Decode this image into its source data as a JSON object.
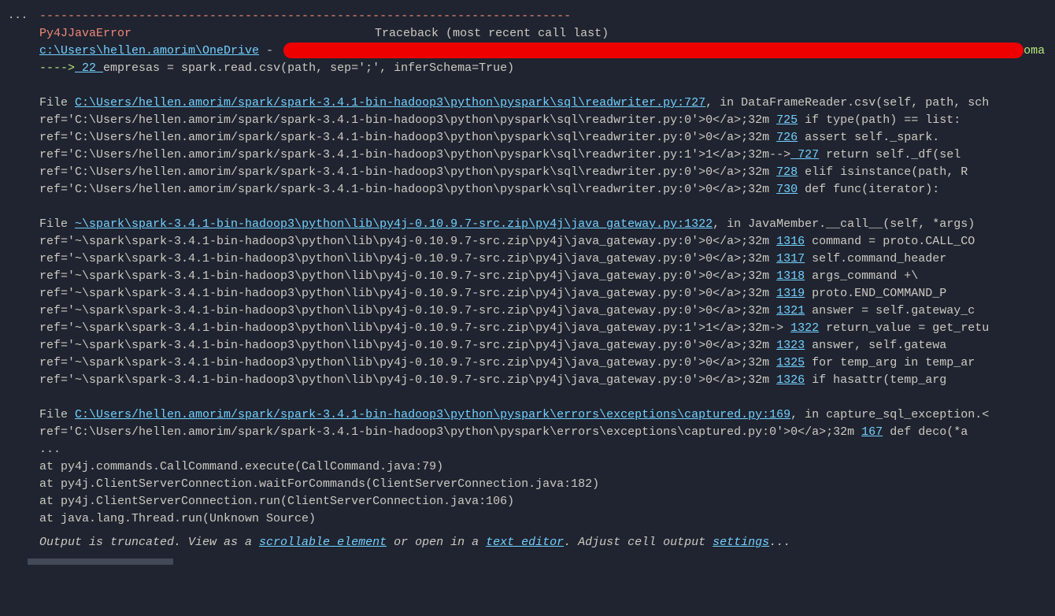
{
  "ellipsis": "···",
  "dashLine": "---------------------------------------------------------------------------",
  "errorName": "Py4JJavaError",
  "tracebackLabel": "Traceback (most recent call last)",
  "headerPath": "c:\\Users\\hellen.amorim\\OneDrive",
  "headerDash": " - ",
  "suffixText": "oma",
  "arrow": "---->",
  "arrowLineNum": " 22 ",
  "arrowCode": "empresas = spark.read.csv(path, sep=';', inferSchema=True)",
  "file1": {
    "prefix": "File ",
    "link": "C:\\Users/hellen.amorim/spark/spark-3.4.1-bin-hadoop3\\python\\pyspark\\sql\\readwriter.py:727",
    "suffix": ", in DataFrameReader.csv(self, path, sch",
    "refs": [
      {
        "ref": "ref='C:\\Users/hellen.amorim/spark/spark-3.4.1-bin-hadoop3\\python\\pyspark\\sql\\readwriter.py:0'>0</a>;32m   ",
        "num": "725",
        "code": " if type(path) == list:"
      },
      {
        "ref": "ref='C:\\Users/hellen.amorim/spark/spark-3.4.1-bin-hadoop3\\python\\pyspark\\sql\\readwriter.py:0'>0</a>;32m   ",
        "num": "726",
        "code": "     assert self._spark."
      },
      {
        "ref": "ref='C:\\Users/hellen.amorim/spark/spark-3.4.1-bin-hadoop3\\python\\pyspark\\sql\\readwriter.py:1'>1</a>;32m-->",
        "num": " 727",
        "code": "     return self._df(sel"
      },
      {
        "ref": "ref='C:\\Users/hellen.amorim/spark/spark-3.4.1-bin-hadoop3\\python\\pyspark\\sql\\readwriter.py:0'>0</a>;32m   ",
        "num": "728",
        "code": " elif isinstance(path, R"
      },
      {
        "ref": "ref='C:\\Users/hellen.amorim/spark/spark-3.4.1-bin-hadoop3\\python\\pyspark\\sql\\readwriter.py:0'>0</a>;32m   ",
        "num": "730",
        "code": "     def func(iterator):"
      }
    ]
  },
  "file2": {
    "prefix": "File ",
    "link": "~\\spark\\spark-3.4.1-bin-hadoop3\\python\\lib\\py4j-0.10.9.7-src.zip\\py4j\\java_gateway.py:1322",
    "suffix": ", in JavaMember.__call__(self, *args)",
    "refs": [
      {
        "ref": "ref='~\\spark\\spark-3.4.1-bin-hadoop3\\python\\lib\\py4j-0.10.9.7-src.zip\\py4j\\java_gateway.py:0'>0</a>;32m   ",
        "num": "1316",
        "code": " command = proto.CALL_CO"
      },
      {
        "ref": "ref='~\\spark\\spark-3.4.1-bin-hadoop3\\python\\lib\\py4j-0.10.9.7-src.zip\\py4j\\java_gateway.py:0'>0</a>;32m   ",
        "num": "1317",
        "code": "     self.command_header"
      },
      {
        "ref": "ref='~\\spark\\spark-3.4.1-bin-hadoop3\\python\\lib\\py4j-0.10.9.7-src.zip\\py4j\\java_gateway.py:0'>0</a>;32m   ",
        "num": "1318",
        "code": "     args_command +\\"
      },
      {
        "ref": "ref='~\\spark\\spark-3.4.1-bin-hadoop3\\python\\lib\\py4j-0.10.9.7-src.zip\\py4j\\java_gateway.py:0'>0</a>;32m   ",
        "num": "1319",
        "code": "     proto.END_COMMAND_P"
      },
      {
        "ref": "ref='~\\spark\\spark-3.4.1-bin-hadoop3\\python\\lib\\py4j-0.10.9.7-src.zip\\py4j\\java_gateway.py:0'>0</a>;32m   ",
        "num": "1321",
        "code": " answer = self.gateway_c"
      },
      {
        "ref": "ref='~\\spark\\spark-3.4.1-bin-hadoop3\\python\\lib\\py4j-0.10.9.7-src.zip\\py4j\\java_gateway.py:1'>1</a>;32m-> ",
        "num": "1322",
        "code": " return_value = get_retu"
      },
      {
        "ref": "ref='~\\spark\\spark-3.4.1-bin-hadoop3\\python\\lib\\py4j-0.10.9.7-src.zip\\py4j\\java_gateway.py:0'>0</a>;32m   ",
        "num": "1323",
        "code": "     answer, self.gatewa"
      },
      {
        "ref": "ref='~\\spark\\spark-3.4.1-bin-hadoop3\\python\\lib\\py4j-0.10.9.7-src.zip\\py4j\\java_gateway.py:0'>0</a>;32m   ",
        "num": "1325",
        "code": " for temp_arg in temp_ar"
      },
      {
        "ref": "ref='~\\spark\\spark-3.4.1-bin-hadoop3\\python\\lib\\py4j-0.10.9.7-src.zip\\py4j\\java_gateway.py:0'>0</a>;32m   ",
        "num": "1326",
        "code": "     if hasattr(temp_arg"
      }
    ]
  },
  "file3": {
    "prefix": "File ",
    "link": "C:\\Users/hellen.amorim/spark/spark-3.4.1-bin-hadoop3\\python\\pyspark\\errors\\exceptions\\captured.py:169",
    "suffix": ", in capture_sql_exception.<",
    "refs": [
      {
        "ref": "ref='C:\\Users/hellen.amorim/spark/spark-3.4.1-bin-hadoop3\\python\\pyspark\\errors\\exceptions\\captured.py:0'>0</a>;32m   ",
        "num": "167",
        "code": " def deco(*a"
      }
    ]
  },
  "dots": "...",
  "javaStack": [
    "        at py4j.commands.CallCommand.execute(CallCommand.java:79)",
    "        at py4j.ClientServerConnection.waitForCommands(ClientServerConnection.java:182)",
    "        at py4j.ClientServerConnection.run(ClientServerConnection.java:106)",
    "        at java.lang.Thread.run(Unknown Source)"
  ],
  "truncation": {
    "p1": "Output is truncated. View as a ",
    "l1": "scrollable element",
    "p2": " or open in a ",
    "l2": "text editor",
    "p3": ". Adjust cell output ",
    "l3": "settings",
    "p4": "..."
  }
}
